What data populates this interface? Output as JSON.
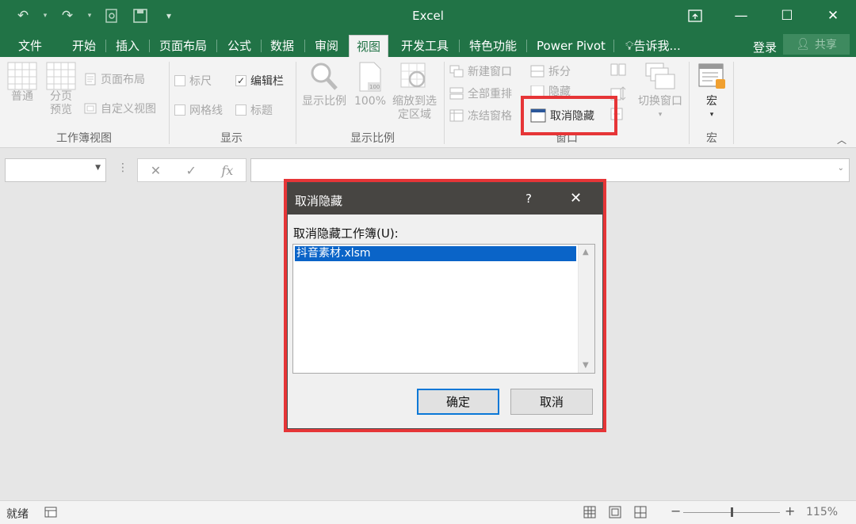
{
  "app": {
    "title": "Excel",
    "colors": {
      "accent": "#217346",
      "highlight": "#e63537",
      "selection": "#0a64c8"
    }
  },
  "qat": {
    "icons": [
      "undo-icon",
      "redo-icon",
      "print-preview-icon",
      "save-icon",
      "customize-icon"
    ]
  },
  "window": {
    "icons": [
      "ribbon-display-icon",
      "minimize-icon",
      "maximize-icon",
      "close-icon"
    ]
  },
  "tabs": {
    "file": "文件",
    "home": "开始",
    "insert": "插入",
    "layout": "页面布局",
    "formulas": "公式",
    "data": "数据",
    "review": "审阅",
    "view": "视图",
    "developer": "开发工具",
    "special": "特色功能",
    "powerpivot": "Power Pivot",
    "tellme": "告诉我...",
    "login": "登录",
    "share": "共享"
  },
  "ribbon": {
    "workbook_views": {
      "normal": "普通",
      "page_break": "分页预览",
      "page_layout": "页面布局",
      "custom_views": "自定义视图",
      "group": "工作簿视图"
    },
    "show": {
      "ruler": "标尺",
      "formula_bar": "编辑栏",
      "gridlines": "网格线",
      "headings": "标题",
      "group": "显示",
      "formula_bar_checked": true
    },
    "zoom": {
      "zoom": "显示比例",
      "zoom100": "100%",
      "zoom_to_selection": "缩放到选定区域",
      "group": "显示比例"
    },
    "window": {
      "new_window": "新建窗口",
      "arrange_all": "全部重排",
      "freeze_panes": "冻结窗格",
      "split": "拆分",
      "hide": "隐藏",
      "unhide": "取消隐藏",
      "switch_windows": "切换窗口",
      "group": "窗口"
    },
    "macros": {
      "macros": "宏",
      "group": "宏"
    }
  },
  "formula_bar": {
    "fx": "fx",
    "cancel": "✕",
    "enter": "✓"
  },
  "dialog": {
    "title": "取消隐藏",
    "help": "?",
    "label": "取消隐藏工作簿(U):",
    "items": [
      "抖音素材.xlsm"
    ],
    "ok": "确定",
    "cancel": "取消"
  },
  "status": {
    "ready": "就绪",
    "zoom_level": "115%",
    "zoom_fraction": 0.5
  }
}
